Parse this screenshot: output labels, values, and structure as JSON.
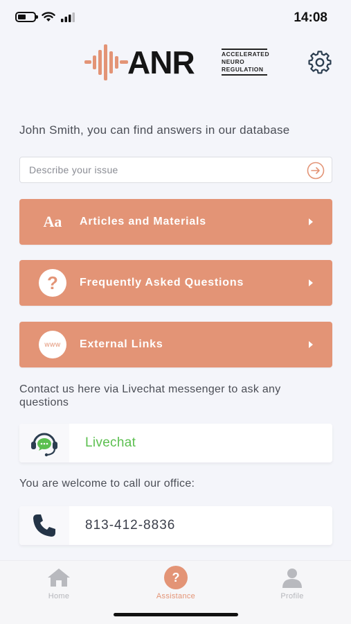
{
  "status_bar": {
    "time": "14:08"
  },
  "header": {
    "logo_text": "ANR",
    "logo_subtitle": [
      "ACCELERATED",
      "NEURO",
      "REGULATION"
    ],
    "brand_color": "#e39476",
    "settings_icon": "gear-icon"
  },
  "intro_text": "John Smith, you can find answers in our database",
  "search": {
    "placeholder": "Describe your issue",
    "value": "",
    "submit_icon": "arrow-right-circle-icon"
  },
  "menu": [
    {
      "label": "Articles and Materials",
      "icon": "text-aa-icon",
      "icon_text": "Aa"
    },
    {
      "label": "Frequently Asked Questions",
      "icon": "question-circle-icon",
      "icon_text": "?"
    },
    {
      "label": "External Links",
      "icon": "www-icon",
      "icon_text": "www"
    }
  ],
  "contact": {
    "livechat_prompt": "Contact us here via Livechat messenger to ask any questions",
    "livechat_label": "Livechat",
    "call_prompt": "You are welcome to call our office:",
    "phone": "813-412-8836"
  },
  "bottom_nav": {
    "items": [
      {
        "label": "Home",
        "icon": "home-icon",
        "active": false
      },
      {
        "label": "Assistance",
        "icon": "question-icon",
        "active": true
      },
      {
        "label": "Profile",
        "icon": "user-icon",
        "active": false
      }
    ]
  }
}
